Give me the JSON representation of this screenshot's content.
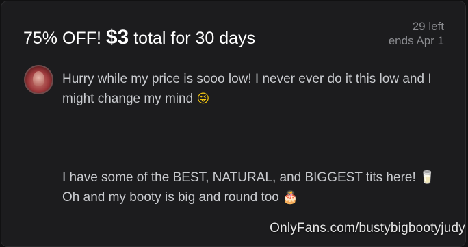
{
  "offer": {
    "headline_prefix": "75% OFF!",
    "price": "$3",
    "headline_suffix": "total for 30 days",
    "remaining": "29 left",
    "ends": "ends Apr 1"
  },
  "message": {
    "paragraph1_text": "Hurry while my price is sooo low! I never ever do it this low and I might change my mind",
    "paragraph1_emoji": "😜",
    "paragraph2_part1": "I have some of the BEST, NATURAL, and BIGGEST tits here!",
    "paragraph2_emoji1": "🥛",
    "paragraph2_part2": "Oh and my booty is big and round too",
    "paragraph2_emoji2": "🎂"
  },
  "watermark": "OnlyFans.com/bustybigbootyjudy",
  "colors": {
    "background": "#111112",
    "card": "#1c1c1e",
    "text_primary": "#ffffff",
    "text_body": "#c9cbcf",
    "text_muted": "#8b8c90"
  },
  "icons": {
    "avatar": "profile-avatar",
    "emoji1": "winking-face-with-tongue-icon",
    "emoji2": "glass-of-milk-icon",
    "emoji3": "birthday-cake-icon"
  }
}
